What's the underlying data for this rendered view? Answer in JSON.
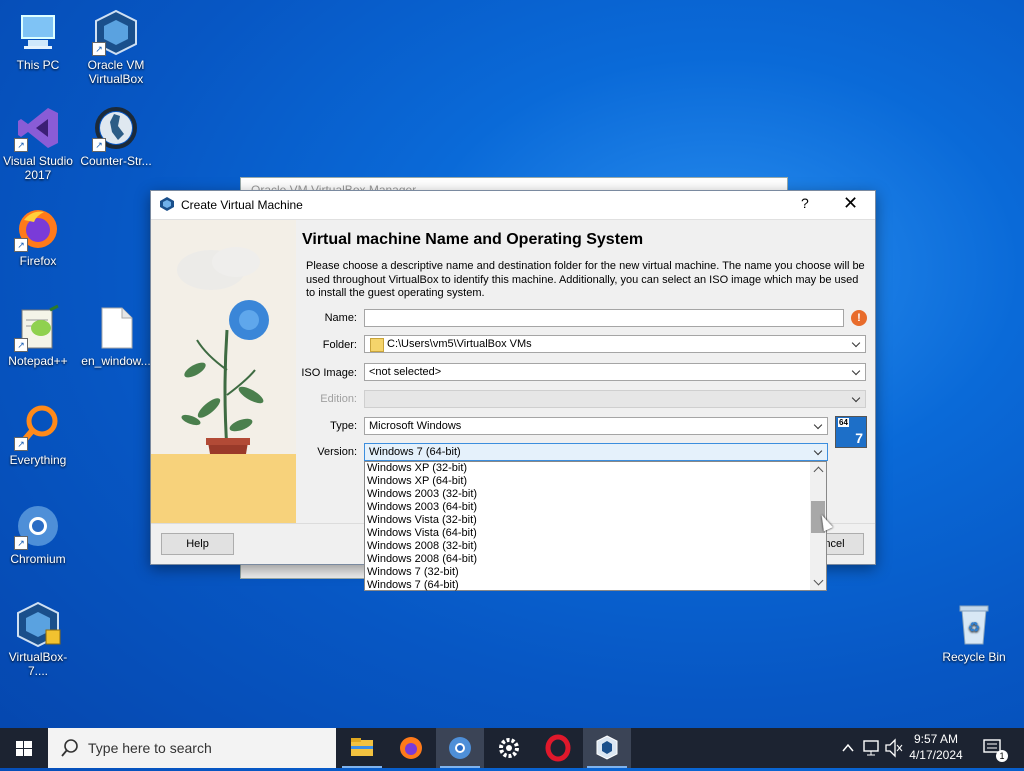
{
  "desktop": {
    "icons": [
      {
        "label": "This PC"
      },
      {
        "label": "Oracle VM VirtualBox"
      },
      {
        "label": "Visual Studio 2017"
      },
      {
        "label": "Counter-Str..."
      },
      {
        "label": "Firefox"
      },
      {
        "label": "Notepad++"
      },
      {
        "label": "en_window..."
      },
      {
        "label": "Everything"
      },
      {
        "label": "Chromium"
      },
      {
        "label": "VirtualBox-7...."
      },
      {
        "label": "Recycle Bin"
      }
    ]
  },
  "bg_window": {
    "title": "Oracle VM VirtualBox Manager"
  },
  "dialog": {
    "title": "Create Virtual Machine",
    "help_glyph": "?",
    "close_glyph": "✕",
    "heading": "Virtual machine Name and Operating System",
    "description": "Please choose a descriptive name and destination folder for the new virtual machine. The name you choose will be used throughout VirtualBox to identify this machine. Additionally, you can select an ISO image which may be used to install the guest operating system.",
    "labels": {
      "name": "Name:",
      "folder": "Folder:",
      "iso": "ISO Image:",
      "edition": "Edition:",
      "type": "Type:",
      "version": "Version:"
    },
    "values": {
      "name": "",
      "folder": "C:\\Users\\vm5\\VirtualBox VMs",
      "iso": "<not selected>",
      "edition": "",
      "type": "Microsoft Windows",
      "version": "Windows 7 (64-bit)"
    },
    "warn_glyph": "!",
    "badge": {
      "bits": "64",
      "ver": "7"
    },
    "buttons": {
      "help": "Help",
      "cancel": "Cancel"
    }
  },
  "version_dropdown": {
    "options": [
      "Windows XP (32-bit)",
      "Windows XP (64-bit)",
      "Windows 2003 (32-bit)",
      "Windows 2003 (64-bit)",
      "Windows Vista (32-bit)",
      "Windows Vista (64-bit)",
      "Windows 2008 (32-bit)",
      "Windows 2008 (64-bit)",
      "Windows 7 (32-bit)",
      "Windows 7 (64-bit)"
    ]
  },
  "taskbar": {
    "search_placeholder": "Type here to search",
    "clock_time": "9:57 AM",
    "clock_date": "4/17/2024",
    "notification_count": "1",
    "apps": [
      "file-explorer",
      "firefox",
      "chromium",
      "settings",
      "opera",
      "virtualbox"
    ]
  },
  "colors": {
    "taskbar": "#1c2331",
    "accent": "#3c8ede",
    "warning": "#e86c2c"
  }
}
